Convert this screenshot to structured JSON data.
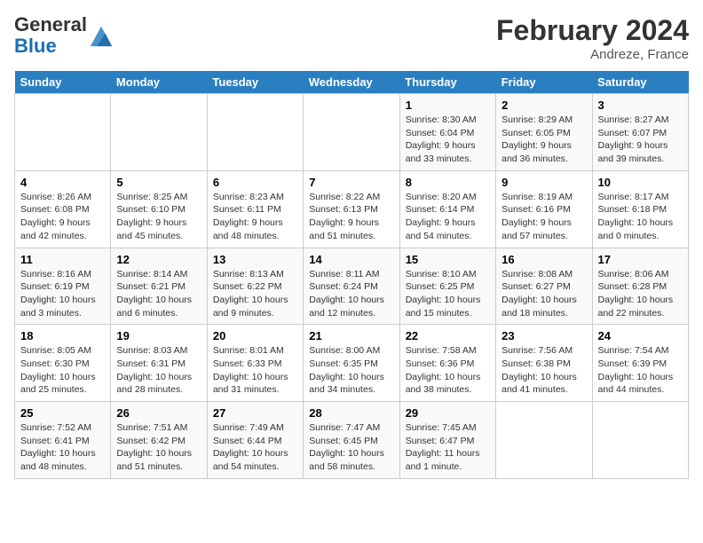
{
  "header": {
    "logo_general": "General",
    "logo_blue": "Blue",
    "month_year": "February 2024",
    "location": "Andreze, France"
  },
  "days_of_week": [
    "Sunday",
    "Monday",
    "Tuesday",
    "Wednesday",
    "Thursday",
    "Friday",
    "Saturday"
  ],
  "weeks": [
    [
      {
        "day": "",
        "info": ""
      },
      {
        "day": "",
        "info": ""
      },
      {
        "day": "",
        "info": ""
      },
      {
        "day": "",
        "info": ""
      },
      {
        "day": "1",
        "info": "Sunrise: 8:30 AM\nSunset: 6:04 PM\nDaylight: 9 hours and 33 minutes."
      },
      {
        "day": "2",
        "info": "Sunrise: 8:29 AM\nSunset: 6:05 PM\nDaylight: 9 hours and 36 minutes."
      },
      {
        "day": "3",
        "info": "Sunrise: 8:27 AM\nSunset: 6:07 PM\nDaylight: 9 hours and 39 minutes."
      }
    ],
    [
      {
        "day": "4",
        "info": "Sunrise: 8:26 AM\nSunset: 6:08 PM\nDaylight: 9 hours and 42 minutes."
      },
      {
        "day": "5",
        "info": "Sunrise: 8:25 AM\nSunset: 6:10 PM\nDaylight: 9 hours and 45 minutes."
      },
      {
        "day": "6",
        "info": "Sunrise: 8:23 AM\nSunset: 6:11 PM\nDaylight: 9 hours and 48 minutes."
      },
      {
        "day": "7",
        "info": "Sunrise: 8:22 AM\nSunset: 6:13 PM\nDaylight: 9 hours and 51 minutes."
      },
      {
        "day": "8",
        "info": "Sunrise: 8:20 AM\nSunset: 6:14 PM\nDaylight: 9 hours and 54 minutes."
      },
      {
        "day": "9",
        "info": "Sunrise: 8:19 AM\nSunset: 6:16 PM\nDaylight: 9 hours and 57 minutes."
      },
      {
        "day": "10",
        "info": "Sunrise: 8:17 AM\nSunset: 6:18 PM\nDaylight: 10 hours and 0 minutes."
      }
    ],
    [
      {
        "day": "11",
        "info": "Sunrise: 8:16 AM\nSunset: 6:19 PM\nDaylight: 10 hours and 3 minutes."
      },
      {
        "day": "12",
        "info": "Sunrise: 8:14 AM\nSunset: 6:21 PM\nDaylight: 10 hours and 6 minutes."
      },
      {
        "day": "13",
        "info": "Sunrise: 8:13 AM\nSunset: 6:22 PM\nDaylight: 10 hours and 9 minutes."
      },
      {
        "day": "14",
        "info": "Sunrise: 8:11 AM\nSunset: 6:24 PM\nDaylight: 10 hours and 12 minutes."
      },
      {
        "day": "15",
        "info": "Sunrise: 8:10 AM\nSunset: 6:25 PM\nDaylight: 10 hours and 15 minutes."
      },
      {
        "day": "16",
        "info": "Sunrise: 8:08 AM\nSunset: 6:27 PM\nDaylight: 10 hours and 18 minutes."
      },
      {
        "day": "17",
        "info": "Sunrise: 8:06 AM\nSunset: 6:28 PM\nDaylight: 10 hours and 22 minutes."
      }
    ],
    [
      {
        "day": "18",
        "info": "Sunrise: 8:05 AM\nSunset: 6:30 PM\nDaylight: 10 hours and 25 minutes."
      },
      {
        "day": "19",
        "info": "Sunrise: 8:03 AM\nSunset: 6:31 PM\nDaylight: 10 hours and 28 minutes."
      },
      {
        "day": "20",
        "info": "Sunrise: 8:01 AM\nSunset: 6:33 PM\nDaylight: 10 hours and 31 minutes."
      },
      {
        "day": "21",
        "info": "Sunrise: 8:00 AM\nSunset: 6:35 PM\nDaylight: 10 hours and 34 minutes."
      },
      {
        "day": "22",
        "info": "Sunrise: 7:58 AM\nSunset: 6:36 PM\nDaylight: 10 hours and 38 minutes."
      },
      {
        "day": "23",
        "info": "Sunrise: 7:56 AM\nSunset: 6:38 PM\nDaylight: 10 hours and 41 minutes."
      },
      {
        "day": "24",
        "info": "Sunrise: 7:54 AM\nSunset: 6:39 PM\nDaylight: 10 hours and 44 minutes."
      }
    ],
    [
      {
        "day": "25",
        "info": "Sunrise: 7:52 AM\nSunset: 6:41 PM\nDaylight: 10 hours and 48 minutes."
      },
      {
        "day": "26",
        "info": "Sunrise: 7:51 AM\nSunset: 6:42 PM\nDaylight: 10 hours and 51 minutes."
      },
      {
        "day": "27",
        "info": "Sunrise: 7:49 AM\nSunset: 6:44 PM\nDaylight: 10 hours and 54 minutes."
      },
      {
        "day": "28",
        "info": "Sunrise: 7:47 AM\nSunset: 6:45 PM\nDaylight: 10 hours and 58 minutes."
      },
      {
        "day": "29",
        "info": "Sunrise: 7:45 AM\nSunset: 6:47 PM\nDaylight: 11 hours and 1 minute."
      },
      {
        "day": "",
        "info": ""
      },
      {
        "day": "",
        "info": ""
      }
    ]
  ]
}
